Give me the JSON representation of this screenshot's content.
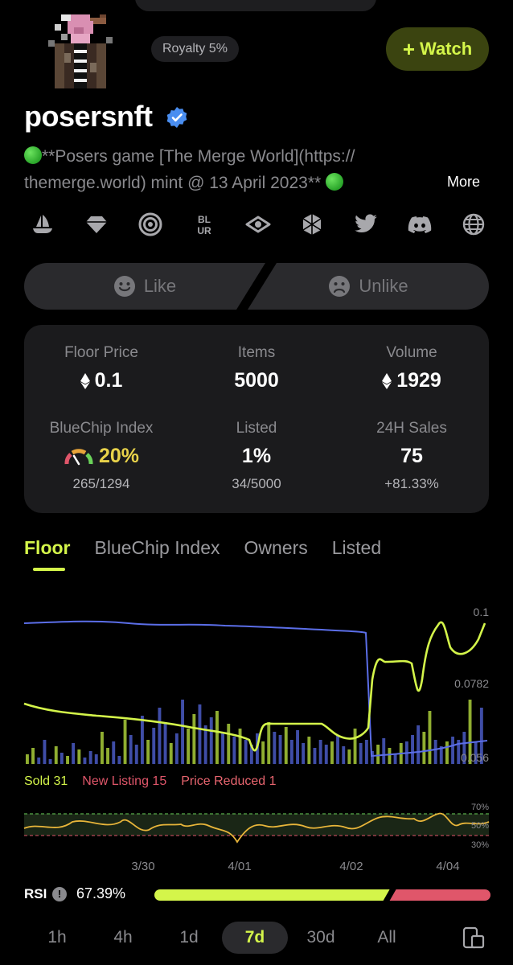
{
  "collection": {
    "name": "posersnft",
    "royalty": "Royalty 5%",
    "watch_label": "Watch",
    "description_line1": "**Posers game [The Merge World](https://",
    "description_line2": "themerge.world) mint @ 13 April 2023**",
    "more_label": "More"
  },
  "social_icons": [
    "opensea-icon",
    "gem-icon",
    "looksrare-icon",
    "blur-icon",
    "x2y2-icon",
    "gem-cube-icon",
    "twitter-icon",
    "discord-icon",
    "globe-icon"
  ],
  "reactions": {
    "like": "Like",
    "unlike": "Unlike"
  },
  "stats": {
    "floor": {
      "label": "Floor Price",
      "value": "0.1"
    },
    "items": {
      "label": "Items",
      "value": "5000"
    },
    "volume": {
      "label": "Volume",
      "value": "1929"
    },
    "bluechip": {
      "label": "BlueChip Index",
      "value": "20%",
      "sub": "265/1294"
    },
    "listed": {
      "label": "Listed",
      "value": "1%",
      "sub": "34/5000"
    },
    "sales": {
      "label": "24H Sales",
      "value": "75",
      "sub": "+81.33%"
    }
  },
  "tabs": [
    "Floor",
    "BlueChip Index",
    "Owners",
    "Listed"
  ],
  "active_tab": "Floor",
  "chart_data": {
    "type": "line",
    "y_ticks": [
      "0.1",
      "0.0782",
      "0.056"
    ],
    "x_ticks": [
      "3/30",
      "4/01",
      "4/02",
      "4/04"
    ],
    "rsi_ticks": [
      "70%",
      "50%",
      "30%"
    ],
    "legend": {
      "sold": "Sold 31",
      "new_listing": "New Listing 15",
      "price_reduced": "Price Reduced 1"
    },
    "colors": {
      "floor": "#d4f54a",
      "listing": "#5b6ee8",
      "bars_blue": "#4a5bc4",
      "bars_green": "#a9cc3a"
    }
  },
  "rsi": {
    "label": "RSI",
    "value": "67.39%",
    "fraction": 0.7
  },
  "ranges": [
    "1h",
    "4h",
    "1d",
    "7d",
    "30d",
    "All"
  ],
  "active_range": "7d"
}
